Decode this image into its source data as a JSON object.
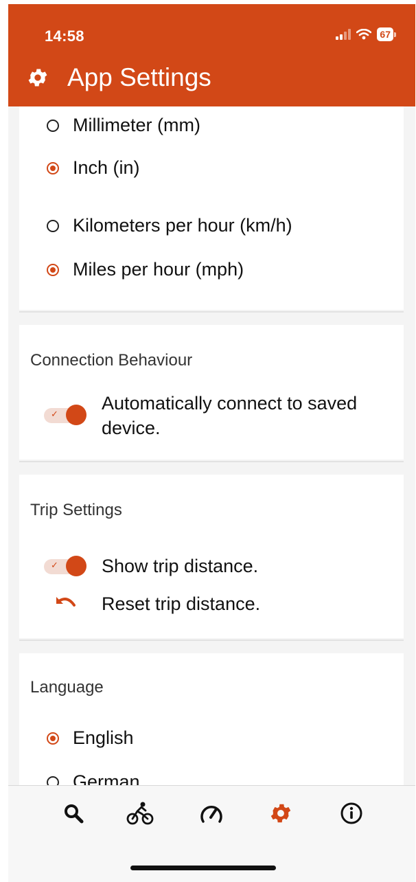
{
  "status_bar": {
    "time": "14:58",
    "battery": "67"
  },
  "header": {
    "title": "App Settings",
    "icon": "gear-icon"
  },
  "units": {
    "length_options": [
      {
        "label": "Millimeter (mm)",
        "selected": false
      },
      {
        "label": "Inch (in)",
        "selected": true
      }
    ],
    "speed_options": [
      {
        "label": "Kilometers per hour (km/h)",
        "selected": false
      },
      {
        "label": "Miles per hour (mph)",
        "selected": true
      }
    ]
  },
  "connection": {
    "title": "Connection Behaviour",
    "auto_connect": {
      "label": "Automatically connect to saved device.",
      "enabled": true
    }
  },
  "trip": {
    "title": "Trip Settings",
    "show_distance": {
      "label": "Show trip distance.",
      "enabled": true
    },
    "reset_distance": {
      "label": "Reset trip distance.",
      "icon": "undo-icon"
    }
  },
  "language": {
    "title": "Language",
    "options": [
      {
        "label": "English",
        "selected": true
      },
      {
        "label": "German",
        "selected": false
      }
    ]
  },
  "tabbar": {
    "tabs": [
      {
        "icon": "search-icon",
        "active": false
      },
      {
        "icon": "bicycle-icon",
        "active": false
      },
      {
        "icon": "speedometer-icon",
        "active": false
      },
      {
        "icon": "gear-icon",
        "active": true
      },
      {
        "icon": "info-icon",
        "active": false
      }
    ]
  },
  "colors": {
    "accent": "#d24817",
    "background": "#f4f4f4",
    "card": "#ffffff"
  }
}
